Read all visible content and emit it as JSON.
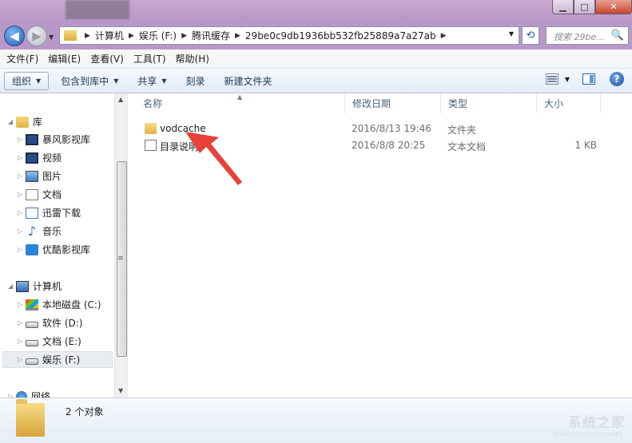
{
  "window": {
    "minimize_glyph": "▁",
    "maximize_glyph": "□",
    "close_glyph": "✕"
  },
  "address": {
    "crumbs": [
      "计算机",
      "娱乐 (F:)",
      "腾讯缓存",
      "29be0c9db1936bb532fb25889a7a27ab"
    ],
    "search_placeholder": "搜索 29be...",
    "search_icon": "🔍",
    "refresh_glyph": "⟲",
    "back_glyph": "◀",
    "forward_glyph": "▶"
  },
  "menu": [
    "文件(F)",
    "编辑(E)",
    "查看(V)",
    "工具(T)",
    "帮助(H)"
  ],
  "toolbar": {
    "organize": "组织",
    "include_in_library": "包含到库中",
    "share": "共享",
    "burn": "刻录",
    "new_folder": "新建文件夹",
    "help_glyph": "?"
  },
  "nav": {
    "library": "库",
    "library_items": [
      "暴风影视库",
      "视频",
      "图片",
      "文档",
      "迅雷下载",
      "音乐",
      "优酷影视库"
    ],
    "computer": "计算机",
    "drives": [
      "本地磁盘 (C:)",
      "软件 (D:)",
      "文档 (E:)",
      "娱乐 (F:)"
    ],
    "network": "网络",
    "music_glyph": "♪"
  },
  "columns": {
    "name": "名称",
    "modified": "修改日期",
    "type": "类型",
    "size": "大小"
  },
  "files": [
    {
      "name": "vodcache",
      "modified": "2016/8/13 19:46",
      "type": "文件夹",
      "size": ""
    },
    {
      "name": "目录说明",
      "modified": "2016/8/8 20:25",
      "type": "文本文档",
      "size": "1 KB"
    }
  ],
  "status": {
    "count_text": "2 个对象"
  },
  "watermark": {
    "text": "系统之家",
    "sub": "WWW.XITONGZHIJIA.NET"
  },
  "colors": {
    "annotation_arrow": "#e8413a",
    "title_bar": "#b596c5"
  }
}
